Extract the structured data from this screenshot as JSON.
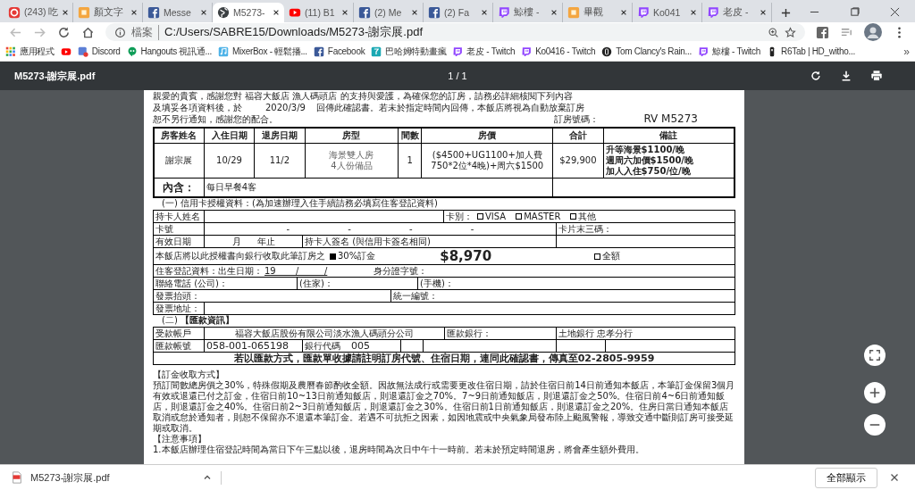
{
  "tabs": [
    {
      "title": "(243) 吃",
      "kind": "ring",
      "selected": false
    },
    {
      "title": "顏文字",
      "kind": "square",
      "selected": false
    },
    {
      "title": "Messe",
      "kind": "facebook",
      "selected": false
    },
    {
      "title": "M5273-",
      "kind": "globe",
      "selected": true
    },
    {
      "title": "(11) B1",
      "kind": "youtube",
      "selected": false
    },
    {
      "title": "(2) Me",
      "kind": "facebook",
      "selected": false
    },
    {
      "title": "(2) Fa",
      "kind": "facebook",
      "selected": false
    },
    {
      "title": "鯨樓 -",
      "kind": "twitch",
      "selected": false
    },
    {
      "title": "畢觀",
      "kind": "square",
      "selected": false
    },
    {
      "title": "Ko041",
      "kind": "twitch",
      "selected": false
    },
    {
      "title": "老皮 -",
      "kind": "twitch",
      "selected": false
    }
  ],
  "address": {
    "scheme": "檔案",
    "url": "C:/Users/SABRE15/Downloads/M5273-謝宗展.pdf"
  },
  "bookmarks": [
    {
      "label": "應用程式",
      "kind": "apps"
    },
    {
      "kind": "youtube"
    },
    {
      "label": "Discord",
      "kind": "discord"
    },
    {
      "label": "Hangouts 視訊通...",
      "kind": "hangouts"
    },
    {
      "label": "MixerBox - 輕鬆播...",
      "kind": "music"
    },
    {
      "label": "Facebook",
      "kind": "facebook"
    },
    {
      "label": "巴哈姆特動畫瘋",
      "kind": "flag"
    },
    {
      "label": "老皮 - Twitch",
      "kind": "twitch"
    },
    {
      "label": "Ko0416 - Twitch",
      "kind": "twitch"
    },
    {
      "label": "Tom Clancy's Rain...",
      "kind": "circle"
    },
    {
      "label": "鯨樓 - Twitch",
      "kind": "twitch"
    },
    {
      "label": "R6Tab | HD_witho...",
      "kind": "bar"
    }
  ],
  "bookmarks_more": "»",
  "pdf_toolbar": {
    "title": "M5273-謝宗展.pdf",
    "page": "1 / 1"
  },
  "document": {
    "intro": {
      "line_1": "親愛的貴賓，感謝您對 福容大飯店 漁人碼頭店 的支持與愛護，為確保您的訂房，請務必詳細核閱下列內容",
      "line_2_start": "及填妥各項資料後，於",
      "deadline": "2020/3/9",
      "line_2_end": "回傳此確認書。若未於指定時間內回傳，本飯店將視為自動放棄訂房",
      "line_3": "恕不另行通知，感謝您的配合。",
      "booking_no_label": "訂房號碼：",
      "booking_no": "RV M5273"
    },
    "booking": {
      "columns": [
        "房客姓名",
        "入住日期",
        "退房日期",
        "房型",
        "間數",
        "房價",
        "合計",
        "備註"
      ],
      "row": [
        [
          "謝宗展"
        ],
        [
          "10/29"
        ],
        [
          "11/2"
        ],
        [
          "海景雙人房",
          "4人份備品"
        ],
        [
          "1"
        ],
        [
          "($4500+UG1100+加人費",
          "750*2位*4晚)+周六$1500"
        ],
        [
          "$29,900"
        ],
        [
          "升等海景$1100/晚",
          "週周六加價$1500/晚",
          "加人入住$750/位/晚"
        ]
      ],
      "included_label": "內含：",
      "included": "每日早餐4客"
    },
    "credit_heading": "(一) 信用卡授權資料：(為加速辦理入住手續請務必填寫住客登記資料)",
    "credit": {
      "holder_label": "持卡人姓名",
      "card_type_label": "卡別：",
      "card_types": [
        {
          "label": "VISA",
          "checked": false
        },
        {
          "label": "MASTER",
          "checked": false
        },
        {
          "label": "其他",
          "checked": false
        }
      ],
      "number_label": "卡號",
      "number_separators": [
        "-",
        "-",
        "-",
        "-"
      ],
      "last3_label": "卡片末三碼：",
      "expiry_label": "有效日期",
      "month": "月",
      "year": "年止",
      "signature_label": "持卡人簽名 (與信用卡簽名相同)",
      "authorize_text": "本飯店將以此授權書向銀行收取此筆訂房之",
      "charge_options": [
        {
          "label": "30%訂金",
          "checked": true
        },
        {
          "label": "全額",
          "checked": false
        }
      ],
      "amount": "$8,970",
      "registration_label": "住客登記資料：出生日期：",
      "birth": "19       /         /",
      "id_label": "身分證字號：",
      "phone_labels": [
        "聯絡電話 (公司)：",
        "(住家)：",
        "(手機)："
      ],
      "invoice_title_label": "發票抬頭：",
      "tax_id_label": "統一編號：",
      "invoice_address_label": "發票地址："
    },
    "remit_heading_number": "(二)",
    "remit_heading": "【匯款資訊】",
    "remit": {
      "payee_label": "受款帳戶",
      "payee": "福容大飯店股份有限公司淡水漁人碼頭分公司",
      "bank_label": "匯款銀行：",
      "bank": "土地銀行 忠孝分行",
      "account_label": "匯款帳號",
      "account": "058-001-065198",
      "bank_code_label": "銀行代碼",
      "bank_code": "005",
      "note": "若以匯款方式，匯款單收據請註明訂房代號、住宿日期，連同此確認書，傳真至02-2805-9959"
    },
    "deposit_heading": "【訂金收取方式】",
    "deposit_text": "預訂間數總房價之30%，特殊假期及農曆春節酌收全額。因故無法成行或需要更改住宿日期，請於住宿日前14日前通知本飯店，本筆訂金保留3個月有效或退還已付之訂金，住宿日前10~13日前通知飯店，則退還訂金之70%。7~9日前通知飯店，則退還訂金之50%。住宿日前4~6日前通知飯店，則退還訂金之40%。住宿日前2~3日前通知飯店，則退還訂金之30%。住宿日前1日前通知飯店，則退還訂金之20%。住房日當日通知本飯店取消或怠於通知者，則恕不保留亦不退還本筆訂金。若遇不可抗拒之因素，如因地震或中央氣象局發布陸上颱風警報，導致交通中斷則訂房可接受延期或取消。",
    "notes_heading": "【注意事項】",
    "note_1": "1.本飯店辦理住宿登記時間為當日下午三點以後，退房時間為次日中午十一時前。若未於預定時間退房，將會產生額外費用。"
  },
  "download": {
    "file": "M5273-謝宗展.pdf",
    "show_all": "全部顯示"
  }
}
